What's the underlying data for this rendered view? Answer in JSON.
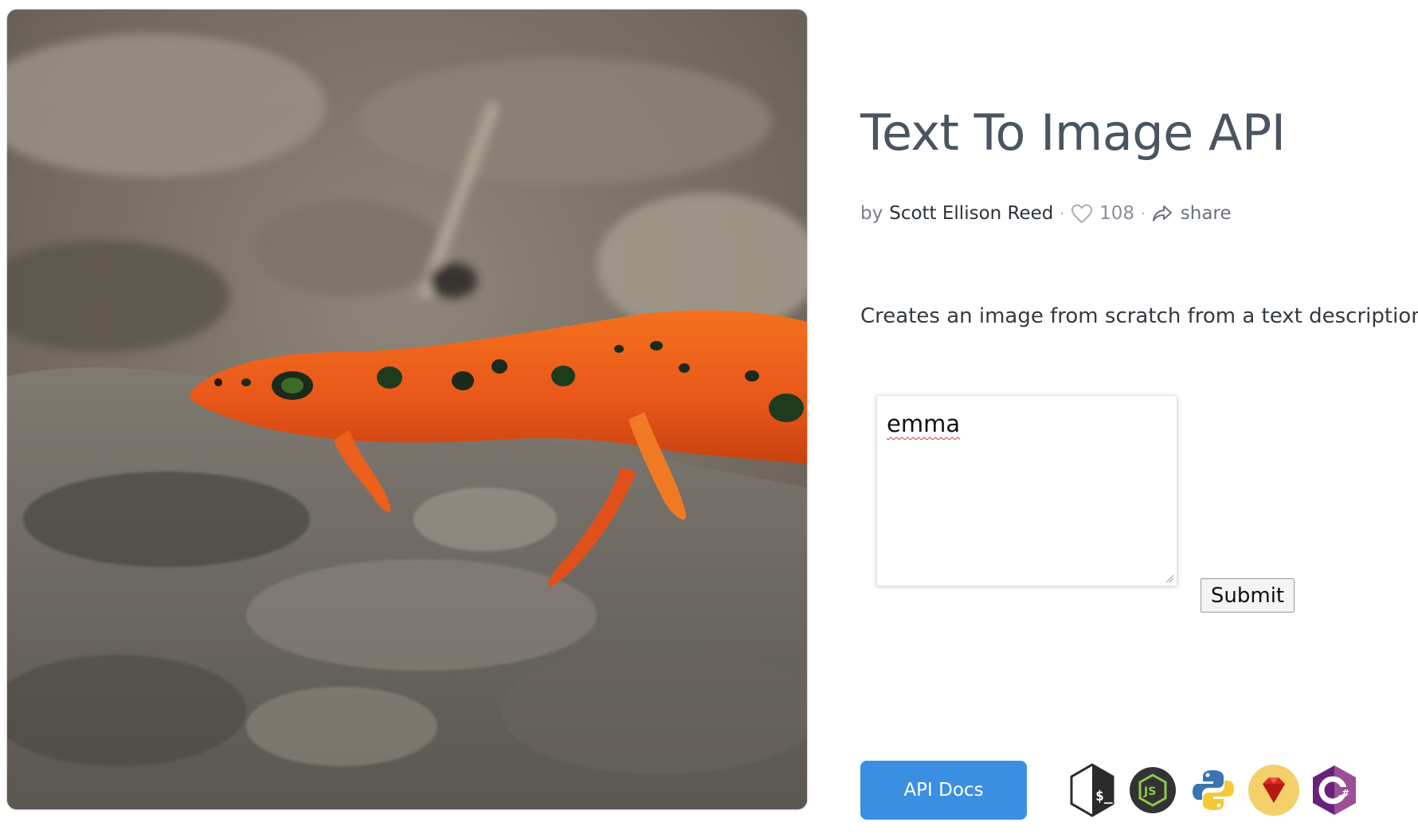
{
  "page": {
    "title": "Text To Image API",
    "byline": {
      "prefix": "by",
      "author": "Scott Ellison Reed",
      "likes": "108",
      "share_label": "share"
    },
    "description": "Creates an image from scratch from a text description.",
    "prompt": {
      "value": "emma",
      "spellcheck_flag": true
    },
    "submit_label": "Submit",
    "api_docs_label": "API Docs",
    "language_icons": [
      "bash-icon",
      "nodejs-icon",
      "python-icon",
      "ruby-icon",
      "csharp-icon"
    ],
    "generated_image": {
      "subject": "orange newt on rock",
      "dominant_colors": [
        "#e8561a",
        "#6b655d",
        "#8c8479"
      ]
    }
  },
  "colors": {
    "title": "#4a5561",
    "accent_button": "#3b8fe3",
    "spellcheck_underline": "#e0302e"
  }
}
